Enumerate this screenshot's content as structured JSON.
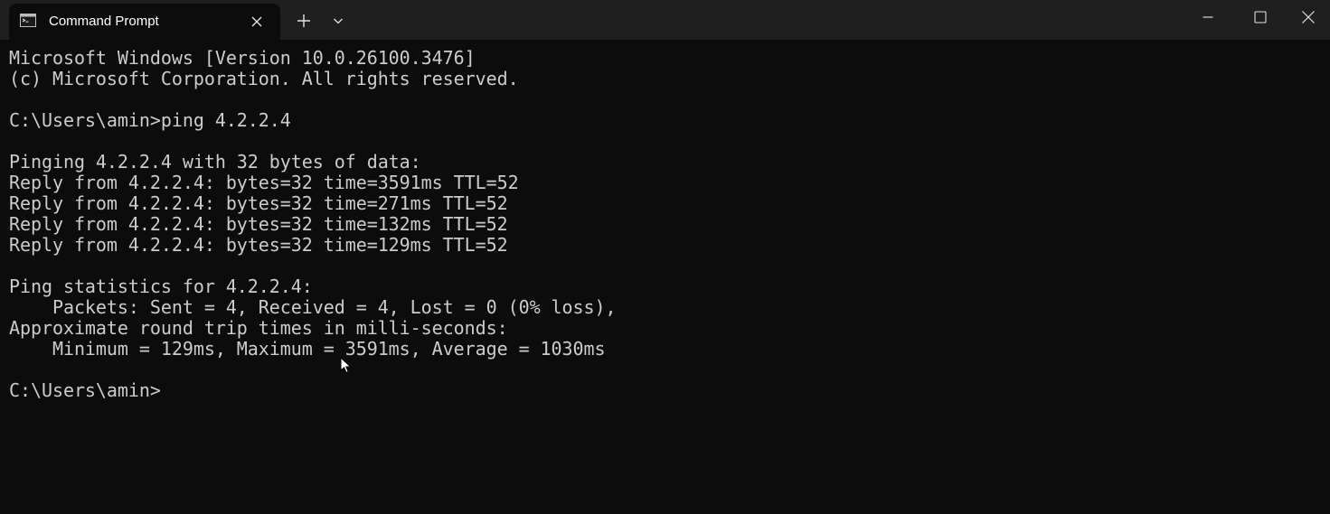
{
  "window": {
    "tab_title": "Command Prompt",
    "icons": {
      "tab": "cmd-icon",
      "close_tab": "close-icon",
      "new_tab": "plus-icon",
      "dropdown": "chevron-down-icon",
      "minimize": "minimize-icon",
      "maximize": "maximize-icon",
      "close_window": "close-icon"
    },
    "colors": {
      "titlebar": "#1f1f1f",
      "terminal_bg": "#0c0c0c",
      "terminal_fg": "#cccccc"
    }
  },
  "terminal": {
    "lines": [
      "Microsoft Windows [Version 10.0.26100.3476]",
      "(c) Microsoft Corporation. All rights reserved.",
      "",
      "C:\\Users\\amin>ping 4.2.2.4",
      "",
      "Pinging 4.2.2.4 with 32 bytes of data:",
      "Reply from 4.2.2.4: bytes=32 time=3591ms TTL=52",
      "Reply from 4.2.2.4: bytes=32 time=271ms TTL=52",
      "Reply from 4.2.2.4: bytes=32 time=132ms TTL=52",
      "Reply from 4.2.2.4: bytes=32 time=129ms TTL=52",
      "",
      "Ping statistics for 4.2.2.4:",
      "    Packets: Sent = 4, Received = 4, Lost = 0 (0% loss),",
      "Approximate round trip times in milli-seconds:",
      "    Minimum = 129ms, Maximum = 3591ms, Average = 1030ms",
      "",
      "C:\\Users\\amin>"
    ]
  }
}
